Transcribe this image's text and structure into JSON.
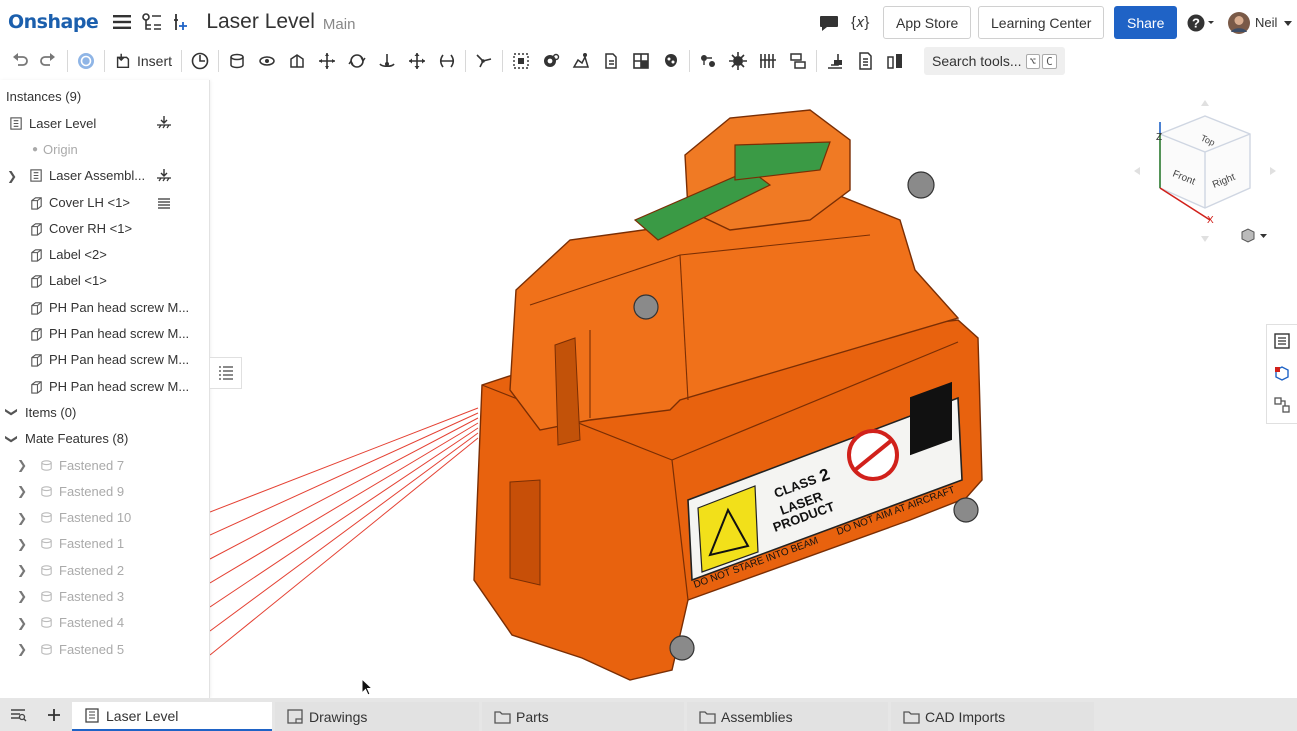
{
  "app": {
    "logo": "Onshape",
    "doc_title": "Laser Level",
    "branch": "Main"
  },
  "header_actions": {
    "app_store": "App Store",
    "learning_center": "Learning Center",
    "share": "Share",
    "user": "Neil",
    "variable_icon": "{𝑥}"
  },
  "toolbar": {
    "insert_label": "Insert",
    "search_label": "Search tools...",
    "shortcut_1": "⌥",
    "shortcut_2": "C"
  },
  "panel": {
    "header": "Instances (9)",
    "instances": [
      {
        "label": "Laser Level",
        "type": "assembly",
        "chev": false,
        "right": "fixed-icon"
      },
      {
        "label": "Origin",
        "type": "origin",
        "chev": false,
        "dim": true
      },
      {
        "label": "Laser Assembl...",
        "type": "assembly",
        "chev": true,
        "right": "fixed-icon"
      },
      {
        "label": "Cover LH <1>",
        "type": "part",
        "chev": false,
        "right": "ground-icon"
      },
      {
        "label": "Cover RH <1>",
        "type": "part",
        "chev": false
      },
      {
        "label": "Label <2>",
        "type": "part",
        "chev": false
      },
      {
        "label": "Label <1>",
        "type": "part",
        "chev": false
      },
      {
        "label": "PH Pan head screw M...",
        "type": "part",
        "chev": false
      },
      {
        "label": "PH Pan head screw M...",
        "type": "part",
        "chev": false
      },
      {
        "label": "PH Pan head screw M...",
        "type": "part",
        "chev": false
      },
      {
        "label": "PH Pan head screw M...",
        "type": "part",
        "chev": false
      }
    ],
    "items_label": "Items (0)",
    "mates_label": "Mate Features (8)",
    "mates": [
      "Fastened 7",
      "Fastened 9",
      "Fastened 10",
      "Fastened 1",
      "Fastened 2",
      "Fastened 3",
      "Fastened 4",
      "Fastened 5"
    ]
  },
  "viewcube": {
    "top": "Top",
    "front": "Front",
    "right": "Right",
    "axis_x": "X",
    "axis_z": "Z"
  },
  "model_label": {
    "class_line1": "CLASS",
    "class_num": "2",
    "laser": "LASER",
    "product": "PRODUCT",
    "warning_1": "DO NOT STARE INTO BEAM",
    "warning_2": "DO NOT AIM AT AIRCRAFT"
  },
  "tabs": [
    "Laser Level",
    "Drawings",
    "Parts",
    "Assemblies",
    "CAD Imports"
  ],
  "colors": {
    "brand": "#1b5fad",
    "primary": "#1f63c6",
    "model": "#e8620e",
    "beam": "#e02010"
  }
}
